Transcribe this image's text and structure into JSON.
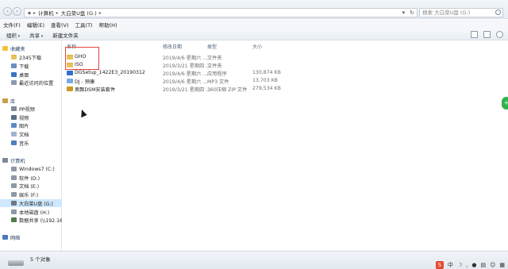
{
  "address": {
    "segments": [
      "计算机",
      "大白菜U盘 (G:)"
    ]
  },
  "search": {
    "placeholder": "搜索 大白菜U盘 (G:)"
  },
  "menubar": [
    "文件(F)",
    "编辑(E)",
    "查看(V)",
    "工具(T)",
    "帮助(H)"
  ],
  "toolbar": {
    "organize": "组织",
    "share": "共享",
    "new_folder": "新建文件夹"
  },
  "sidebar": {
    "favorites": {
      "label": "收藏夹",
      "items": [
        "2345下载",
        "下载",
        "桌面",
        "最近访问的位置"
      ]
    },
    "libraries": {
      "label": "库",
      "items": [
        "PP视频",
        "视频",
        "图片",
        "文档",
        "音乐"
      ]
    },
    "computer": {
      "label": "计算机",
      "items": [
        "Windows7 (C:)",
        "软件 (D:)",
        "文档 (E:)",
        "娱乐 (F:)",
        "大白菜U盘 (G:)",
        "本地磁盘 (H:)",
        "数据共享 (\\\\192.168"
      ]
    },
    "network": {
      "label": "网络"
    }
  },
  "columns": {
    "name": "名称",
    "date": "修改日期",
    "type": "类型",
    "size": "大小"
  },
  "files": [
    {
      "name": "GHO",
      "date": "2019/4/6 星期六 ...",
      "type": "文件夹",
      "size": "",
      "icon": "folder-icon"
    },
    {
      "name": "ISO",
      "date": "2019/3/21 星期四 ...",
      "type": "文件夹",
      "size": "",
      "icon": "folder-icon"
    },
    {
      "name": "DGSetup_1422E3_20190312",
      "date": "2019/4/6 星期六 ...",
      "type": "应用程序",
      "size": "130,874 KB",
      "icon": "application-icon"
    },
    {
      "name": "DJ - 预康",
      "date": "2019/4/6 星期六 ...",
      "type": "MP3 文件",
      "size": "13,703 KB",
      "icon": "mp3-icon"
    },
    {
      "name": "奥飘DSM安装套件",
      "date": "2019/3/21 星期四 ...",
      "type": "360压缩 ZIP 文件",
      "size": "279,534 KB",
      "icon": "zip-icon"
    }
  ],
  "status": {
    "count_text": "5 个对象"
  },
  "colors": {
    "selection": "#cde8ff",
    "highlight_box": "#e0453a",
    "folder": "#e8c25a"
  }
}
